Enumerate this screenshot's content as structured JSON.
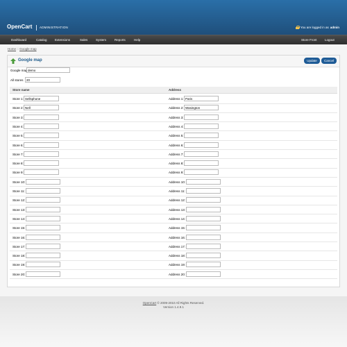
{
  "header": {
    "logo": "OpenCart",
    "admin_label": "ADMINISTRATION",
    "logged_prefix": "You are logged in as",
    "username": "admin"
  },
  "menu": {
    "left": [
      "Dashboard",
      "Catalog",
      "Extensions",
      "Sales",
      "System",
      "Reports",
      "Help"
    ],
    "store_front": "Store Front",
    "logout": "Logout"
  },
  "breadcrumb": {
    "home": "Home",
    "separator": "::",
    "current": "Google map"
  },
  "page": {
    "title": "Google map",
    "update": "Update",
    "cancel": "Cancel",
    "key_label": "Google map key",
    "key_value": "demo",
    "all_stores_label": "All stores",
    "all_stores_value": "20"
  },
  "table": {
    "col_store": "Store name",
    "col_address": "Address",
    "rows": [
      {
        "store_label": "Store 1:",
        "store_value": "Sellsphone",
        "address_label": "Address 1:",
        "address_value": "Paris"
      },
      {
        "store_label": "Store 2:",
        "store_value": "Nell",
        "address_label": "Address 2:",
        "address_value": "Wasington"
      },
      {
        "store_label": "Store 3:",
        "store_value": "",
        "address_label": "Address 3:",
        "address_value": ""
      },
      {
        "store_label": "Store 4:",
        "store_value": "",
        "address_label": "Address 4:",
        "address_value": ""
      },
      {
        "store_label": "Store 5:",
        "store_value": "",
        "address_label": "Address 5:",
        "address_value": ""
      },
      {
        "store_label": "Store 6:",
        "store_value": "",
        "address_label": "Address 6:",
        "address_value": ""
      },
      {
        "store_label": "Store 7:",
        "store_value": "",
        "address_label": "Address 7:",
        "address_value": ""
      },
      {
        "store_label": "Store 8:",
        "store_value": "",
        "address_label": "Address 8:",
        "address_value": ""
      },
      {
        "store_label": "Store 9:",
        "store_value": "",
        "address_label": "Address 9:",
        "address_value": ""
      },
      {
        "store_label": "Store 10:",
        "store_value": "",
        "address_label": "Address 10:",
        "address_value": ""
      },
      {
        "store_label": "Store 11:",
        "store_value": "",
        "address_label": "Address 11:",
        "address_value": ""
      },
      {
        "store_label": "Store 12:",
        "store_value": "",
        "address_label": "Address 12:",
        "address_value": ""
      },
      {
        "store_label": "Store 13:",
        "store_value": "",
        "address_label": "Address 13:",
        "address_value": ""
      },
      {
        "store_label": "Store 14:",
        "store_value": "",
        "address_label": "Address 14:",
        "address_value": ""
      },
      {
        "store_label": "Store 15:",
        "store_value": "",
        "address_label": "Address 15:",
        "address_value": ""
      },
      {
        "store_label": "Store 16:",
        "store_value": "",
        "address_label": "Address 16:",
        "address_value": ""
      },
      {
        "store_label": "Store 17:",
        "store_value": "",
        "address_label": "Address 17:",
        "address_value": ""
      },
      {
        "store_label": "Store 18:",
        "store_value": "",
        "address_label": "Address 18:",
        "address_value": ""
      },
      {
        "store_label": "Store 19:",
        "store_value": "",
        "address_label": "Address 19:",
        "address_value": ""
      },
      {
        "store_label": "Store 20:",
        "store_value": "",
        "address_label": "Address 20:",
        "address_value": ""
      }
    ]
  },
  "footer": {
    "brand": "OpenCart",
    "copyright": "© 2009-2010 All Rights Reserved.",
    "version": "Version 1.4.9.1"
  }
}
